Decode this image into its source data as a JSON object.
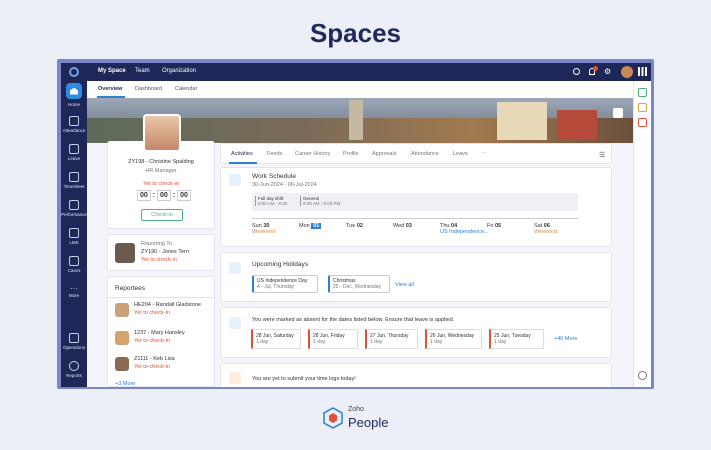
{
  "page_title": "Spaces",
  "nav": {
    "tabs": [
      "My Space",
      "Team",
      "Organization"
    ]
  },
  "sidebar": {
    "items": [
      "Home",
      "Attendance",
      "Leave",
      "Timesheet",
      "Performance",
      "LMS",
      "Cases",
      "More",
      "Operations",
      "Reports"
    ]
  },
  "subnav": {
    "tabs": [
      "Overview",
      "Dashboard",
      "Calendar"
    ]
  },
  "profile": {
    "id_name": "ZY198 - Christine Spalding",
    "role": "HR Manager",
    "status": "Yet to check-in",
    "timer": [
      "00",
      "00",
      "00"
    ],
    "checkin": "Check-in"
  },
  "reporting": {
    "label": "Reporting To",
    "name": "ZY190 - Jones Terri",
    "status": "Yet to check-in"
  },
  "reportees": {
    "title": "Reportees",
    "items": [
      {
        "name": "HE204 - Randall Gladstone",
        "status": "Yet to check-in"
      },
      {
        "name": "1237 - Mary Hansley",
        "status": "Yet to check-in"
      },
      {
        "name": "Z1111 - Keb Lisa",
        "status": "Yet to check-in"
      }
    ],
    "more": "+3 More"
  },
  "tabs": [
    "Activities",
    "Feeds",
    "Career History",
    "Profile",
    "Approvals",
    "Attendance",
    "Leave",
    "···"
  ],
  "schedule": {
    "title": "Work Schedule",
    "range": "30-Jun-2024  -  06-Jul-2024",
    "shift1": "Full day shift",
    "shift1_time": "9:00 AM - 6:00",
    "shift2": "General",
    "shift2_time": "9:00 AM - 6:00 PM",
    "days": [
      {
        "d": "Sun",
        "n": "30",
        "note": "Weekend"
      },
      {
        "d": "Mon",
        "n": "01",
        "note": ""
      },
      {
        "d": "Tue",
        "n": "02",
        "note": ""
      },
      {
        "d": "Wed",
        "n": "03",
        "note": ""
      },
      {
        "d": "Thu",
        "n": "04",
        "note": "US Independence..."
      },
      {
        "d": "Fri",
        "n": "05",
        "note": ""
      },
      {
        "d": "Sat",
        "n": "06",
        "note": "Weekend"
      }
    ]
  },
  "holidays": {
    "title": "Upcoming Holidays",
    "items": [
      {
        "name": "US Independence Day",
        "date": "4 - Jul, Thursday"
      },
      {
        "name": "Christmas",
        "date": "25 - Dec, Wednesday"
      }
    ],
    "view_all": "View all"
  },
  "absent": {
    "title": "You were marked as absent for the dates listed below. Ensure that leave is applied.",
    "items": [
      {
        "date": "28 Jun, Saturday",
        "days": "1 day"
      },
      {
        "date": "28 Jun, Friday",
        "days": "1 day"
      },
      {
        "date": "27 Jun, Thursday",
        "days": "1 day"
      },
      {
        "date": "26 Jun, Wednesday",
        "days": "1 day"
      },
      {
        "date": "25 Jun, Tuesday",
        "days": "1 day"
      }
    ],
    "more": "+40 More"
  },
  "timelog": {
    "title": "You are yet to submit your time logs today!"
  },
  "brand": {
    "small": "Zoho",
    "big": "People"
  }
}
